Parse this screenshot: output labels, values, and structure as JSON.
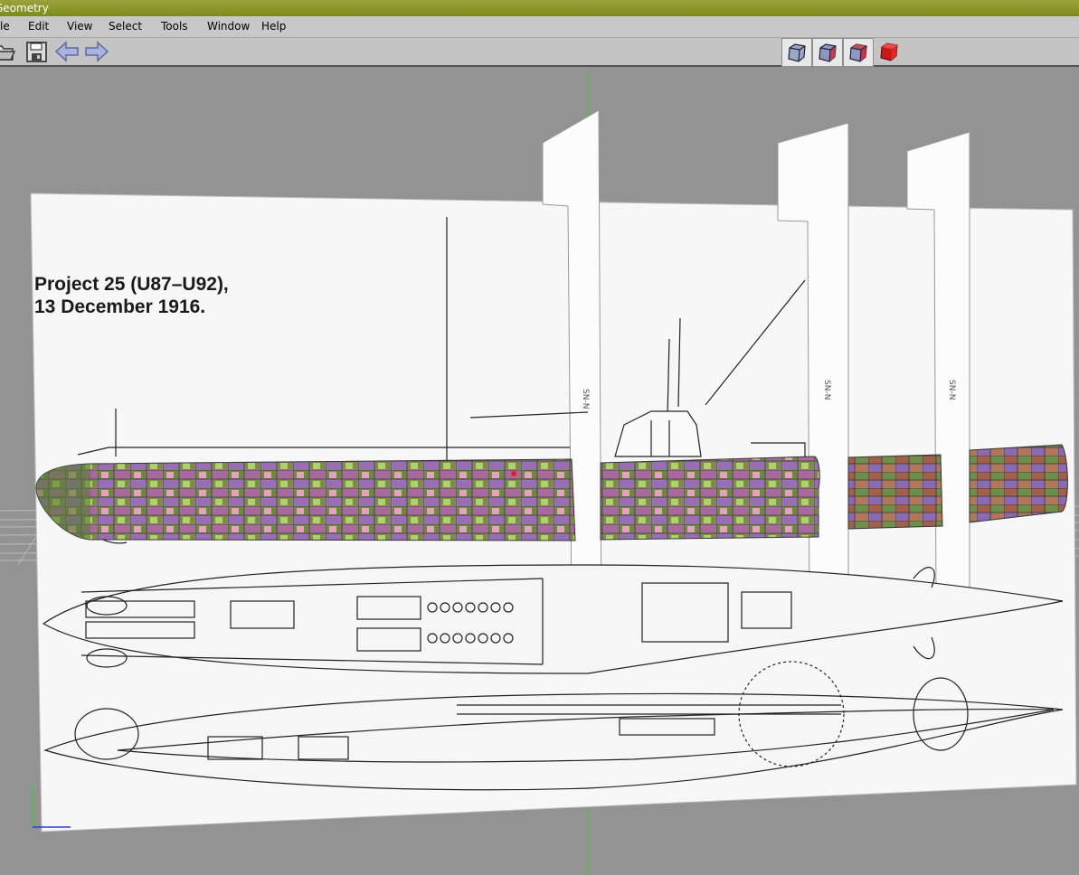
{
  "window": {
    "title": "Geometry"
  },
  "menu": {
    "items": [
      "le",
      "Edit",
      "View",
      "Select",
      "Tools",
      "Window",
      "Help"
    ]
  },
  "toolbar": {
    "buttons": [
      "open-icon",
      "save-icon",
      "undo-arrow-icon",
      "redo-arrow-icon"
    ],
    "view_modes": [
      "wireframe-cube-icon",
      "shaded-wire-cube-icon",
      "textured-wire-cube-icon",
      "solid-red-cube-icon"
    ]
  },
  "blueprint": {
    "title_line1": "Project 25 (U87–U92),",
    "title_line2": "13 December 1916."
  },
  "colors": {
    "accent_titlebar": "#8c9626",
    "viewport_bg": "#939393",
    "axis_green": "#3cc83c",
    "axis_red": "#e02020",
    "axis_blue": "#2040e0"
  }
}
